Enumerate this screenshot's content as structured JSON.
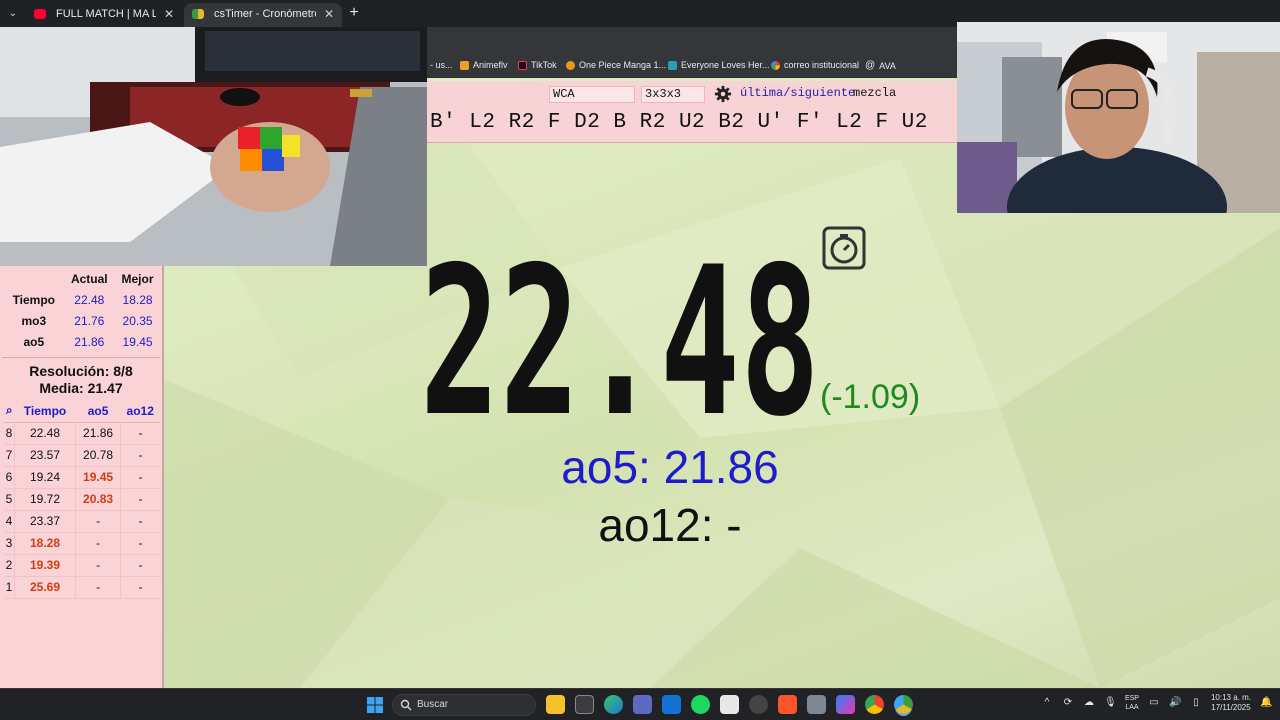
{
  "browser": {
    "tabs": [
      {
        "label": "FULL MATCH | MA Long (CHN)",
        "icon": "youtube-icon",
        "color": "#ff0033"
      },
      {
        "label": "csTimer - Cronómetro profesional",
        "icon": "cstimer-icon",
        "color": "#3c9c3c"
      }
    ],
    "tab_close": "✕",
    "new_tab": "+",
    "bookmarks": [
      {
        "label": "- us...",
        "icon": "",
        "color": "#777777"
      },
      {
        "label": "Animeflv",
        "icon": "animeflv-icon",
        "color": "#f0a020"
      },
      {
        "label": "TikTok",
        "icon": "tiktok-icon",
        "color": "#111111"
      },
      {
        "label": "One Piece Manga 1...",
        "icon": "onepiece-icon",
        "color": "#e89b1a"
      },
      {
        "label": "Everyone Loves Her...",
        "icon": "bookmark-icon",
        "color": "#2a9fb0"
      },
      {
        "label": "correo institucional",
        "icon": "google-icon",
        "color": "#4285f4"
      },
      {
        "label": "AVA",
        "icon": "at-icon",
        "color": "#dddddd"
      }
    ]
  },
  "cstimer": {
    "event_select": "WCA",
    "puzzle_select": "3x3x3",
    "nav_link": "última/siguiente",
    "nav_word": "mezcla",
    "scramble": "B' L2 R2 F D2 B R2 U2 B2 U' F' L2 F U2",
    "timer": "22.48",
    "diff": "(-1.09)",
    "ao5": "ao5: 21.86",
    "ao12": "ao12: -"
  },
  "stats": {
    "headers": [
      "",
      "Actual",
      "Mejor"
    ],
    "rows": [
      {
        "label": "Tiempo",
        "actual": "22.48",
        "best": "18.28"
      },
      {
        "label": "mo3",
        "actual": "21.76",
        "best": "20.35"
      },
      {
        "label": "ao5",
        "actual": "21.86",
        "best": "19.45"
      }
    ],
    "resolution": "Resolución: 8/8",
    "mean": "Media: 21.47"
  },
  "times_table": {
    "headers": [
      "⌕",
      "Tiempo",
      "ao5",
      "ao12"
    ],
    "rows": [
      {
        "n": "8",
        "time": "22.48",
        "ao5": "21.86",
        "ao12": "-",
        "time_best": false,
        "ao5_best": false
      },
      {
        "n": "7",
        "time": "23.57",
        "ao5": "20.78",
        "ao12": "-",
        "time_best": false,
        "ao5_best": false
      },
      {
        "n": "6",
        "time": "19.24",
        "ao5": "19.45",
        "ao12": "-",
        "time_best": false,
        "ao5_best": true
      },
      {
        "n": "5",
        "time": "19.72",
        "ao5": "20.83",
        "ao12": "-",
        "time_best": false,
        "ao5_best": true
      },
      {
        "n": "4",
        "time": "23.37",
        "ao5": "-",
        "ao12": "-",
        "time_best": false,
        "ao5_best": false
      },
      {
        "n": "3",
        "time": "18.28",
        "ao5": "-",
        "ao12": "-",
        "time_best": true,
        "ao5_best": false
      },
      {
        "n": "2",
        "time": "19.39",
        "ao5": "-",
        "ao12": "-",
        "time_best": true,
        "ao5_best": false
      },
      {
        "n": "1",
        "time": "25.69",
        "ao5": "-",
        "ao12": "-",
        "time_best": true,
        "ao5_best": false
      }
    ]
  },
  "taskbar": {
    "search_placeholder": "Buscar",
    "lang_top": "ESP",
    "lang_bottom": "LAA",
    "time": "10:13 a. m.",
    "date": "17/11/2025"
  },
  "colors": {
    "accent_blue": "#1c1ccc",
    "best_red": "#d23b12",
    "diff_green": "#1e8a1e",
    "panel_pink": "#fad3d6"
  }
}
